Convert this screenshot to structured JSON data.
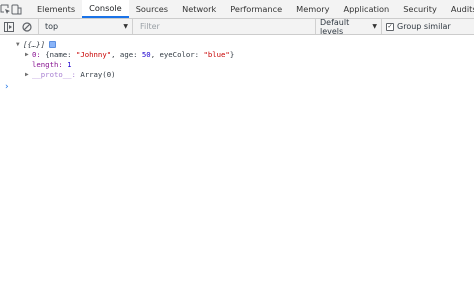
{
  "tabs": {
    "items": [
      "Elements",
      "Console",
      "Sources",
      "Network",
      "Performance",
      "Memory",
      "Application",
      "Security",
      "Audits"
    ],
    "active_index": 1
  },
  "toolbar": {
    "context": "top",
    "filter_placeholder": "Filter",
    "levels_label": "Default levels",
    "group_similar_label": "Group similar",
    "group_similar_checked": true
  },
  "console": {
    "array_header": "[{…}]",
    "entry_index": "0:",
    "entry_object": "{name: \"Johnny\", age: 50, eyeColor: \"blue\"}",
    "entry_name_key": "name",
    "entry_name_value": "\"Johnny\"",
    "entry_age_key": "age",
    "entry_age_value": "50",
    "entry_eye_key": "eyeColor",
    "entry_eye_value": "\"blue\"",
    "length_key": "length",
    "length_value": "1",
    "proto_key": "__proto__",
    "proto_value": "Array(0)",
    "prompt_symbol": "›"
  },
  "colors": {
    "accent": "#1a73e8",
    "key_purple": "#881391",
    "string_red": "#c80000",
    "number_blue": "#1c00cf"
  }
}
